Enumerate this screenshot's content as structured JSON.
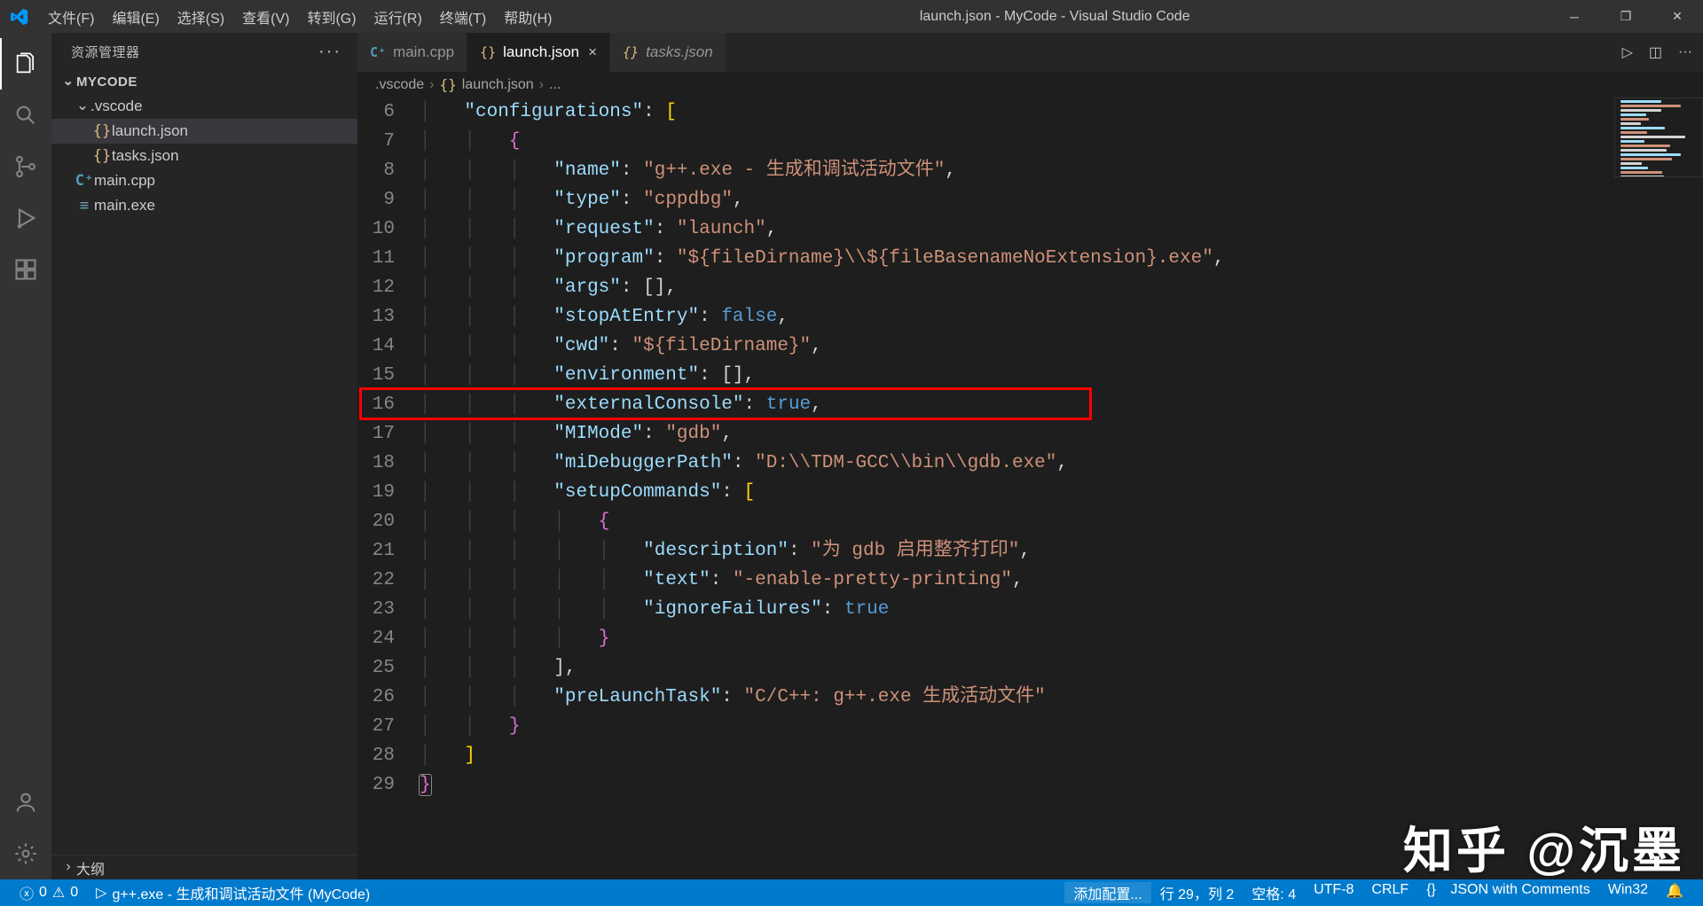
{
  "title": "launch.json - MyCode - Visual Studio Code",
  "menu": [
    "文件(F)",
    "编辑(E)",
    "选择(S)",
    "查看(V)",
    "转到(G)",
    "运行(R)",
    "终端(T)",
    "帮助(H)"
  ],
  "sidebar": {
    "title": "资源管理器",
    "root": "MYCODE",
    "tree": [
      {
        "type": "folder",
        "name": ".vscode",
        "depth": 1,
        "open": true
      },
      {
        "type": "file",
        "name": "launch.json",
        "depth": 2,
        "iconClass": "file-icon-json",
        "icon": "{}",
        "selected": true
      },
      {
        "type": "file",
        "name": "tasks.json",
        "depth": 2,
        "iconClass": "file-icon-json",
        "icon": "{}"
      },
      {
        "type": "file",
        "name": "main.cpp",
        "depth": 1,
        "iconClass": "file-icon-cpp",
        "icon": "C⁺"
      },
      {
        "type": "file",
        "name": "main.exe",
        "depth": 1,
        "iconClass": "file-icon-exe",
        "icon": "≡"
      }
    ],
    "outline": "大纲"
  },
  "tabs": [
    {
      "label": "main.cpp",
      "iconClass": "file-icon-cpp",
      "icon": "C⁺",
      "active": false,
      "italic": false
    },
    {
      "label": "launch.json",
      "iconClass": "file-icon-json",
      "icon": "{}",
      "active": true,
      "close": true
    },
    {
      "label": "tasks.json",
      "iconClass": "file-icon-json",
      "icon": "{}",
      "active": false,
      "italic": true
    }
  ],
  "breadcrumbs": [
    ".vscode",
    "launch.json",
    "..."
  ],
  "code": {
    "startLine": 6,
    "lines": [
      [
        [
          "    ",
          ""
        ],
        [
          "\"configurations\"",
          "k"
        ],
        [
          ": ",
          "p"
        ],
        [
          "[",
          "y"
        ]
      ],
      [
        [
          "        ",
          ""
        ],
        [
          "{",
          "brace"
        ]
      ],
      [
        [
          "            ",
          ""
        ],
        [
          "\"name\"",
          "k"
        ],
        [
          ": ",
          "p"
        ],
        [
          "\"g++.exe - 生成和调试活动文件\"",
          "s"
        ],
        [
          ",",
          "p"
        ]
      ],
      [
        [
          "            ",
          ""
        ],
        [
          "\"type\"",
          "k"
        ],
        [
          ": ",
          "p"
        ],
        [
          "\"cppdbg\"",
          "s"
        ],
        [
          ",",
          "p"
        ]
      ],
      [
        [
          "            ",
          ""
        ],
        [
          "\"request\"",
          "k"
        ],
        [
          ": ",
          "p"
        ],
        [
          "\"launch\"",
          "s"
        ],
        [
          ",",
          "p"
        ]
      ],
      [
        [
          "            ",
          ""
        ],
        [
          "\"program\"",
          "k"
        ],
        [
          ": ",
          "p"
        ],
        [
          "\"${fileDirname}\\\\${fileBasenameNoExtension}.exe\"",
          "s"
        ],
        [
          ",",
          "p"
        ]
      ],
      [
        [
          "            ",
          ""
        ],
        [
          "\"args\"",
          "k"
        ],
        [
          ": ",
          "p"
        ],
        [
          "[]",
          "p"
        ],
        [
          ",",
          "p"
        ]
      ],
      [
        [
          "            ",
          ""
        ],
        [
          "\"stopAtEntry\"",
          "k"
        ],
        [
          ": ",
          "p"
        ],
        [
          "false",
          "b"
        ],
        [
          ",",
          "p"
        ]
      ],
      [
        [
          "            ",
          ""
        ],
        [
          "\"cwd\"",
          "k"
        ],
        [
          ": ",
          "p"
        ],
        [
          "\"${fileDirname}\"",
          "s"
        ],
        [
          ",",
          "p"
        ]
      ],
      [
        [
          "            ",
          ""
        ],
        [
          "\"environment\"",
          "k"
        ],
        [
          ": ",
          "p"
        ],
        [
          "[]",
          "p"
        ],
        [
          ",",
          "p"
        ]
      ],
      [
        [
          "            ",
          ""
        ],
        [
          "\"externalConsole\"",
          "k"
        ],
        [
          ": ",
          "p"
        ],
        [
          "true",
          "b"
        ],
        [
          ",",
          "p"
        ]
      ],
      [
        [
          "            ",
          ""
        ],
        [
          "\"MIMode\"",
          "k"
        ],
        [
          ": ",
          "p"
        ],
        [
          "\"gdb\"",
          "s"
        ],
        [
          ",",
          "p"
        ]
      ],
      [
        [
          "            ",
          ""
        ],
        [
          "\"miDebuggerPath\"",
          "k"
        ],
        [
          ": ",
          "p"
        ],
        [
          "\"D:\\\\TDM-GCC\\\\bin\\\\gdb.exe\"",
          "s"
        ],
        [
          ",",
          "p"
        ]
      ],
      [
        [
          "            ",
          ""
        ],
        [
          "\"setupCommands\"",
          "k"
        ],
        [
          ": ",
          "p"
        ],
        [
          "[",
          "y"
        ]
      ],
      [
        [
          "                ",
          ""
        ],
        [
          "{",
          "brace"
        ]
      ],
      [
        [
          "                    ",
          ""
        ],
        [
          "\"description\"",
          "k"
        ],
        [
          ": ",
          "p"
        ],
        [
          "\"为 gdb 启用整齐打印\"",
          "s"
        ],
        [
          ",",
          "p"
        ]
      ],
      [
        [
          "                    ",
          ""
        ],
        [
          "\"text\"",
          "k"
        ],
        [
          ": ",
          "p"
        ],
        [
          "\"-enable-pretty-printing\"",
          "s"
        ],
        [
          ",",
          "p"
        ]
      ],
      [
        [
          "                    ",
          ""
        ],
        [
          "\"ignoreFailures\"",
          "k"
        ],
        [
          ": ",
          "p"
        ],
        [
          "true",
          "b"
        ]
      ],
      [
        [
          "                ",
          ""
        ],
        [
          "}",
          "brace"
        ]
      ],
      [
        [
          "            ",
          ""
        ],
        [
          "],",
          "p"
        ]
      ],
      [
        [
          "            ",
          ""
        ],
        [
          "\"preLaunchTask\"",
          "k"
        ],
        [
          ": ",
          "p"
        ],
        [
          "\"C/C++: g++.exe 生成活动文件\"",
          "s"
        ]
      ],
      [
        [
          "        ",
          ""
        ],
        [
          "}",
          "brace"
        ]
      ],
      [
        [
          "    ",
          ""
        ],
        [
          "]",
          "y"
        ]
      ],
      [
        [
          "",
          ""
        ],
        [
          "}",
          "brace current"
        ]
      ]
    ],
    "highlightLine": 16
  },
  "status": {
    "errors": "0",
    "warnings": "0",
    "launchConfig": "g++.exe - 生成和调试活动文件 (MyCode)",
    "lncol": "行 29，列 2",
    "spaces": "空格: 4",
    "encoding": "UTF-8",
    "eol": "CRLF",
    "language": "JSON with Comments",
    "os": "Win32",
    "addConfig": "添加配置..."
  },
  "watermark": "知乎 @沉墨"
}
